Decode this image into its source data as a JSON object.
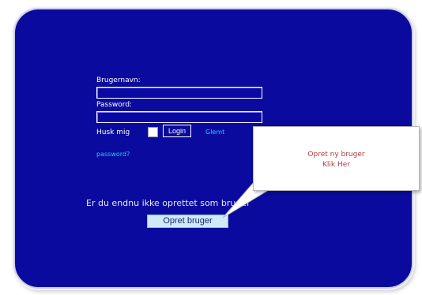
{
  "login": {
    "username_label": "Brugernavn:",
    "username_value": "",
    "password_label": "Password:",
    "password_value": "",
    "remember_label": "Husk mig",
    "remember_checked": false,
    "login_button": "Login",
    "forgot_link_line1": "Glemt",
    "forgot_link_line2": "password?"
  },
  "signup": {
    "question": "Er du endnu ikke oprettet som bruger",
    "button": "Opret bruger"
  },
  "callout": {
    "line1": "Opret ny bruger",
    "line2": "Klik Her"
  },
  "colors": {
    "panel_background": "#0a0a9e",
    "link": "#29c6ff",
    "callout_text": "#b23a3a",
    "signup_button": "#cfe9f9"
  }
}
